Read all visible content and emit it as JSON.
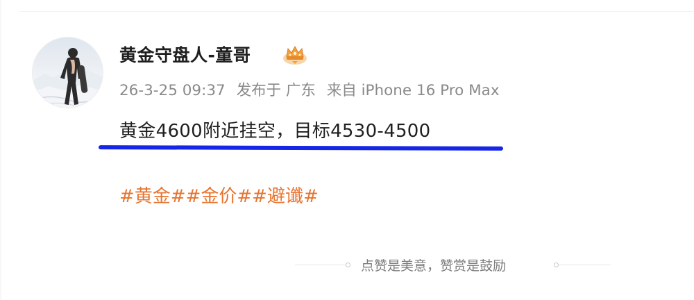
{
  "post": {
    "author": "黄金守盘人-童哥",
    "badge_icon": "crown-badge-icon",
    "meta": {
      "time": "26-3-25 09:37",
      "location": "发布于 广东",
      "source": "来自 iPhone 16 Pro Max"
    },
    "text": "黄金4600附近挂空，目标4530-4500",
    "hashtags": [
      "#黄金#",
      "#金价#",
      "#避谶#"
    ]
  },
  "footer": {
    "label": "点赞是美意，赞赏是鼓励"
  },
  "colors": {
    "hashtag": "#e8742f",
    "underline": "#1626e6",
    "text": "#1f1f1f",
    "meta": "#8a8a8a"
  }
}
